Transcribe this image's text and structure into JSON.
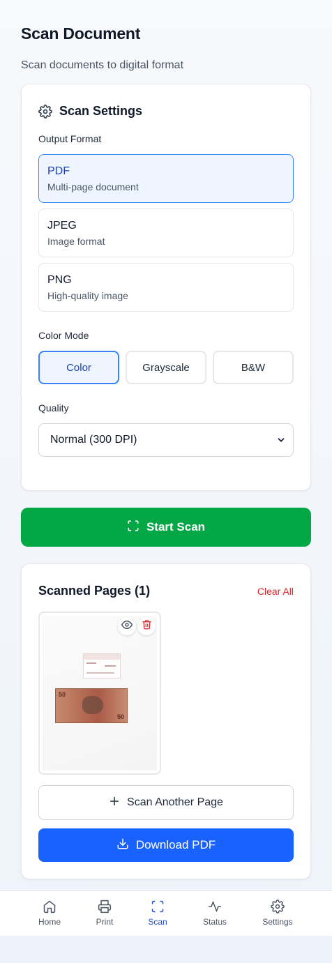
{
  "header": {
    "title": "Scan Document",
    "subtitle": "Scan documents to digital format"
  },
  "settings": {
    "title": "Scan Settings",
    "title_icon": "gear-icon",
    "output_format_label": "Output Format",
    "formats": [
      {
        "name": "PDF",
        "description": "Multi-page document",
        "selected": true
      },
      {
        "name": "JPEG",
        "description": "Image format",
        "selected": false
      },
      {
        "name": "PNG",
        "description": "High-quality image",
        "selected": false
      }
    ],
    "color_mode_label": "Color Mode",
    "color_modes": [
      {
        "label": "Color",
        "selected": true
      },
      {
        "label": "Grayscale",
        "selected": false
      },
      {
        "label": "B&W",
        "selected": false
      }
    ],
    "quality_label": "Quality",
    "quality_value": "Normal (300 DPI)"
  },
  "start_scan": {
    "label": "Start Scan",
    "icon": "scan-frame-icon"
  },
  "scanned": {
    "title": "Scanned Pages (1)",
    "clear_all_label": "Clear All",
    "pages": [
      {
        "preview_icon": "eye-icon",
        "delete_icon": "trash-icon"
      }
    ],
    "scan_another_label": "Scan Another Page",
    "download_label": "Download PDF"
  },
  "nav": {
    "items": [
      {
        "label": "Home",
        "icon": "home-icon",
        "active": false
      },
      {
        "label": "Print",
        "icon": "printer-icon",
        "active": false
      },
      {
        "label": "Scan",
        "icon": "scan-frame-icon",
        "active": true
      },
      {
        "label": "Status",
        "icon": "activity-icon",
        "active": false
      },
      {
        "label": "Settings",
        "icon": "gear-icon",
        "active": false
      }
    ]
  },
  "colors": {
    "accent_blue": "#1a62ff",
    "selected_border": "#3b82f6",
    "start_green": "#03a745",
    "danger_red": "#dc2626"
  }
}
